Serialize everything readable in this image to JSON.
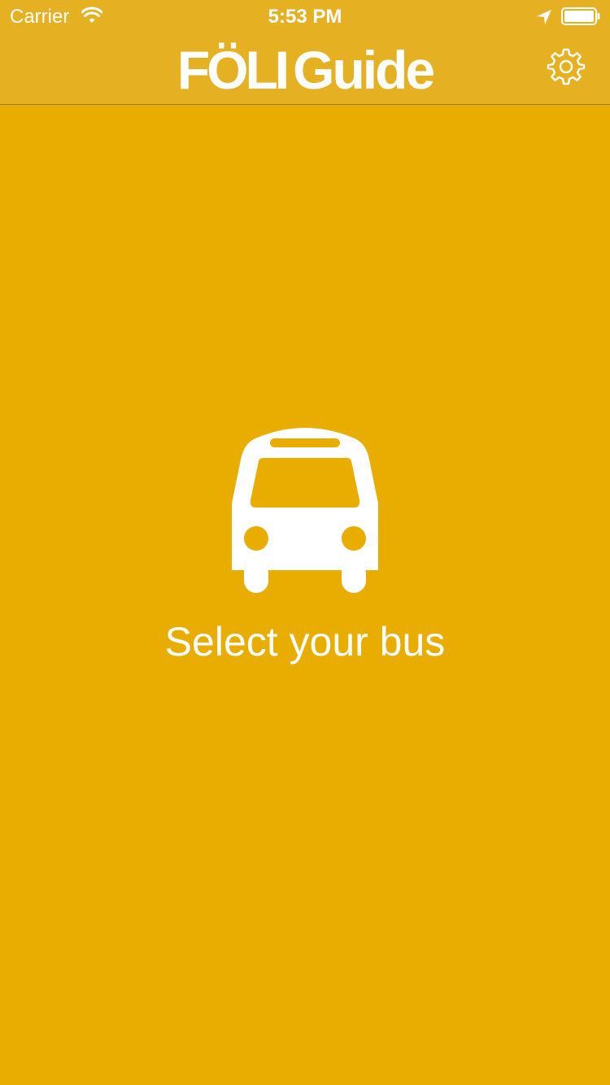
{
  "status_bar": {
    "carrier": "Carrier",
    "time": "5:53 PM",
    "wifi_icon": "wifi-icon",
    "location_icon": "location-arrow-icon",
    "battery_icon": "battery-full-icon"
  },
  "header": {
    "logo_part1": "FÖLI",
    "logo_part2": "Guide",
    "settings_icon": "gear-icon"
  },
  "main": {
    "icon": "bus-icon",
    "prompt": "Select your bus"
  },
  "colors": {
    "background": "#e8ad00",
    "header_background": "#e6b023",
    "foreground": "#ffffff"
  }
}
